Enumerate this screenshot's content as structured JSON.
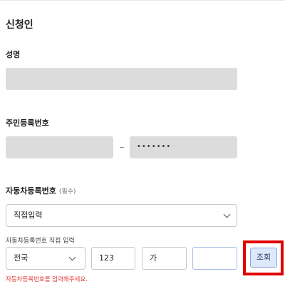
{
  "section_title": "신청인",
  "name": {
    "label": "성명",
    "value": ""
  },
  "resident_number": {
    "label": "주민등록번호",
    "front_value": "",
    "back_masked": "•••••••"
  },
  "vehicle": {
    "label": "자동차등록번호",
    "required_tag": "(필수)",
    "input_method": "직접입력",
    "direct_input_label": "자동차등록번호 직접 입력",
    "region": "전국",
    "number_part": "123",
    "hangul_part": "가",
    "last_part": "",
    "query_button": "조회",
    "error_message": "자동차등록번호를 입력해주세요."
  }
}
